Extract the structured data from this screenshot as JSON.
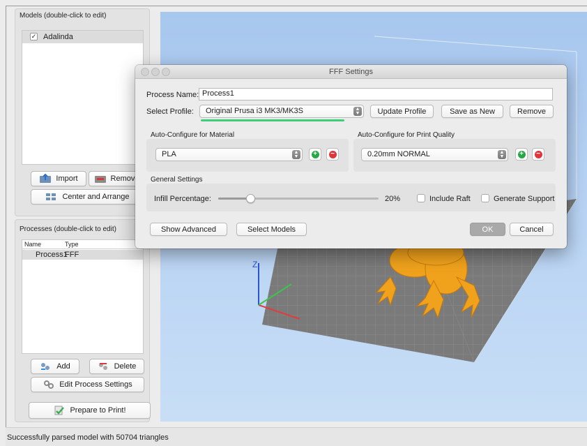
{
  "models": {
    "title": "Models (double-click to edit)",
    "items": [
      {
        "name": "Adalinda",
        "checked": true
      }
    ],
    "import_label": "Import",
    "remove_label": "Remove",
    "center_label": "Center and Arrange"
  },
  "processes": {
    "title": "Processes (double-click to edit)",
    "columns": [
      "Name",
      "Type"
    ],
    "rows": [
      {
        "name": "Process1",
        "type": "FFF"
      }
    ],
    "add_label": "Add",
    "delete_label": "Delete",
    "edit_label": "Edit Process Settings",
    "prepare_label": "Prepare to Print!"
  },
  "viewport": {
    "z_axis_label": "Z"
  },
  "status": "Successfully parsed model with 50704 triangles",
  "dialog": {
    "title": "FFF Settings",
    "process_name_label": "Process Name:",
    "process_name_value": "Process1",
    "select_profile_label": "Select Profile:",
    "profile_value": "Original Prusa i3 MK3/MK3S",
    "update_profile": "Update Profile",
    "save_as_new": "Save as New",
    "remove": "Remove",
    "material_group_title": "Auto-Configure for Material",
    "material_value": "PLA",
    "quality_group_title": "Auto-Configure for Print Quality",
    "quality_value": "0.20mm NORMAL",
    "general_title": "General Settings",
    "infill_label": "Infill Percentage:",
    "infill_value": "20%",
    "infill_fraction": 0.2,
    "include_raft": "Include Raft",
    "generate_support": "Generate Support",
    "show_advanced": "Show Advanced",
    "select_models": "Select Models",
    "ok": "OK",
    "cancel": "Cancel"
  },
  "colors": {
    "accent_underline": "#3ccf7a",
    "add_green": "#27a844",
    "remove_red": "#e0363b",
    "model_orange": "#f0a21c",
    "bed_grey": "#7a7a7a"
  }
}
